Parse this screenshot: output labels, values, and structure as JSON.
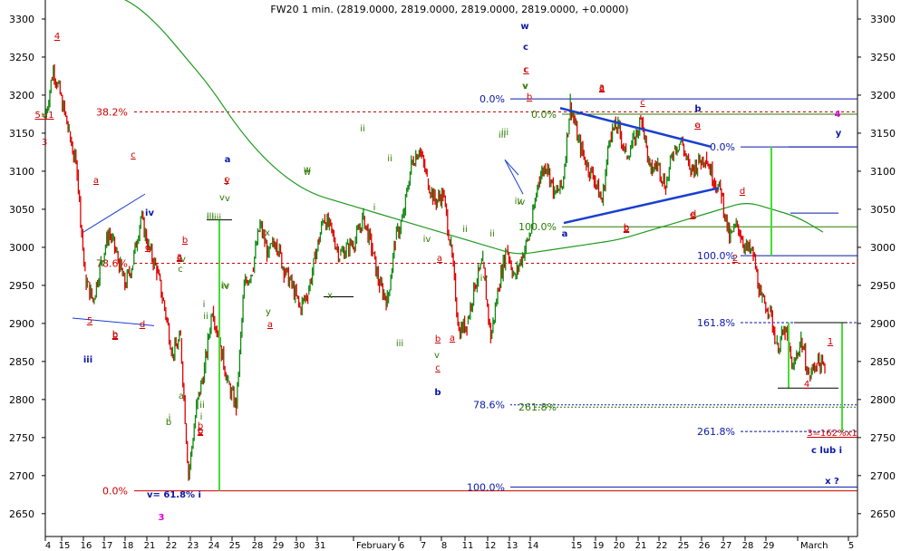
{
  "colors": {
    "background": "#ffffff",
    "up_candle": "#118a11",
    "down_candle": "#e00000",
    "moving_average": "#1f9a1f",
    "annotation_red": "#cc0000",
    "annotation_blue": "#0a18a8",
    "annotation_green": "#2d7a00",
    "annotation_magenta": "#e000e0",
    "trendline_blue": "#1a3fd0",
    "projection_green": "#44dd33"
  },
  "chart_data": {
    "type": "line",
    "title": "FW20 1 min. (2819.0000, 2819.0000, 2819.0000, 2819.0000, +0.0000)",
    "ylim": [
      2620,
      3325
    ],
    "yticks": [
      2650,
      2700,
      2750,
      2800,
      2850,
      2900,
      2950,
      3000,
      3050,
      3100,
      3150,
      3200,
      3250,
      3300
    ],
    "x_labels": [
      "4",
      "15",
      "16",
      "17",
      "18",
      "21",
      "22",
      "23",
      "24",
      "25",
      "28",
      "29",
      "30",
      "31",
      "February",
      "6",
      "7",
      "8",
      "11",
      "12",
      "13",
      "14",
      "15",
      "19",
      "20",
      "21",
      "22",
      "25",
      "26",
      "27",
      "28",
      "29",
      "March",
      "5"
    ],
    "grid": false,
    "legend": "none",
    "series": [
      {
        "values": [
          3170,
          3235,
          3195,
          3150,
          3100,
          2960,
          2930,
          2980,
          3020,
          2990,
          2950,
          2980,
          3040,
          3000,
          2970,
          2920,
          2860,
          2880,
          2700,
          2790,
          2840,
          2920,
          2870,
          2820,
          2790,
          2950,
          2970,
          3030,
          2990,
          3010,
          2970,
          2950,
          2920,
          2940,
          2990,
          3040,
          3020,
          2990,
          3000,
          3010,
          3040,
          3000,
          2950,
          2930,
          3010,
          3040,
          3110,
          3130,
          3090,
          3060,
          3070,
          3000,
          2890,
          2900,
          2950,
          2980,
          2880,
          2950,
          3000,
          2960,
          2990,
          3020,
          3090,
          3110,
          3070,
          3080,
          3190,
          3140,
          3110,
          3090,
          3060,
          3150,
          3160,
          3120,
          3140,
          3170,
          3100,
          3110,
          3080,
          3130,
          3140,
          3100,
          3110,
          3120,
          3090,
          3070,
          3010,
          3030,
          3000,
          2990,
          2930,
          2920,
          2870,
          2890,
          2840,
          2880,
          2830,
          2850,
          2840
        ]
      },
      {
        "name": "moving average",
        "values": [
          3335,
          3320,
          3290,
          3250,
          3210,
          3160,
          3120,
          3090,
          3070,
          3060,
          3050,
          3040,
          3030,
          3020,
          3010,
          3000,
          2990,
          2995,
          3000,
          3005,
          3010,
          3020,
          3030,
          3040,
          3050,
          3060,
          3050,
          3040,
          3020
        ]
      }
    ],
    "annotations": {
      "red": [
        "4",
        "a",
        "c",
        "5",
        "b",
        "d",
        "e",
        "3",
        "a",
        "b",
        "c",
        "b",
        "b",
        "a",
        "c",
        "a",
        "a",
        "b",
        "c",
        "a",
        "c",
        "a",
        "b",
        "c",
        "e",
        "d",
        "2",
        "1",
        "4",
        "3=162%x1",
        "5=1",
        "y",
        "c",
        "b",
        "a",
        "c",
        "b",
        "a",
        "d",
        "b"
      ],
      "blue": [
        "w",
        "c",
        "iv",
        "iii",
        "a",
        "b",
        "a",
        "b",
        "y",
        "c lub i",
        "x ?",
        "v= 61.8% i"
      ],
      "green": [
        "iii",
        "ii",
        "iv",
        "v",
        "w",
        "x",
        "y",
        "v",
        "iii",
        "iv",
        "v",
        "iii",
        "iv",
        "ii",
        "i",
        "iii",
        "ii",
        "iv",
        "v",
        "a",
        "b",
        "c",
        "ii",
        "i",
        "w",
        "ii",
        "x",
        "iv",
        "iii",
        "v",
        "i",
        "ii",
        "iii",
        "iv",
        "v",
        "v",
        "i"
      ],
      "magenta": [
        "4",
        "3"
      ]
    },
    "fib_levels": [
      {
        "label": "38.2%",
        "value": 3178,
        "color": "red"
      },
      {
        "label": "0.0%",
        "value": 2680,
        "color": "red"
      },
      {
        "label": "78.6%",
        "value": 2979,
        "color": "red"
      },
      {
        "label": "0.0%",
        "value": 3195,
        "color": "blue"
      },
      {
        "label": "100.0%",
        "value": 2685,
        "color": "blue"
      },
      {
        "label": "78.6%",
        "value": 2793,
        "color": "blue"
      },
      {
        "label": "0.0%",
        "value": 3132,
        "color": "blue"
      },
      {
        "label": "100.0%",
        "value": 2989,
        "color": "blue"
      },
      {
        "label": "161.8%",
        "value": 2901,
        "color": "blue"
      },
      {
        "label": "261.8%",
        "value": 2758,
        "color": "blue"
      },
      {
        "label": "0.0%",
        "value": 3175,
        "color": "green"
      },
      {
        "label": "100.0%",
        "value": 3027,
        "color": "green"
      },
      {
        "label": "261.8%",
        "value": 2790,
        "color": "green"
      }
    ]
  }
}
